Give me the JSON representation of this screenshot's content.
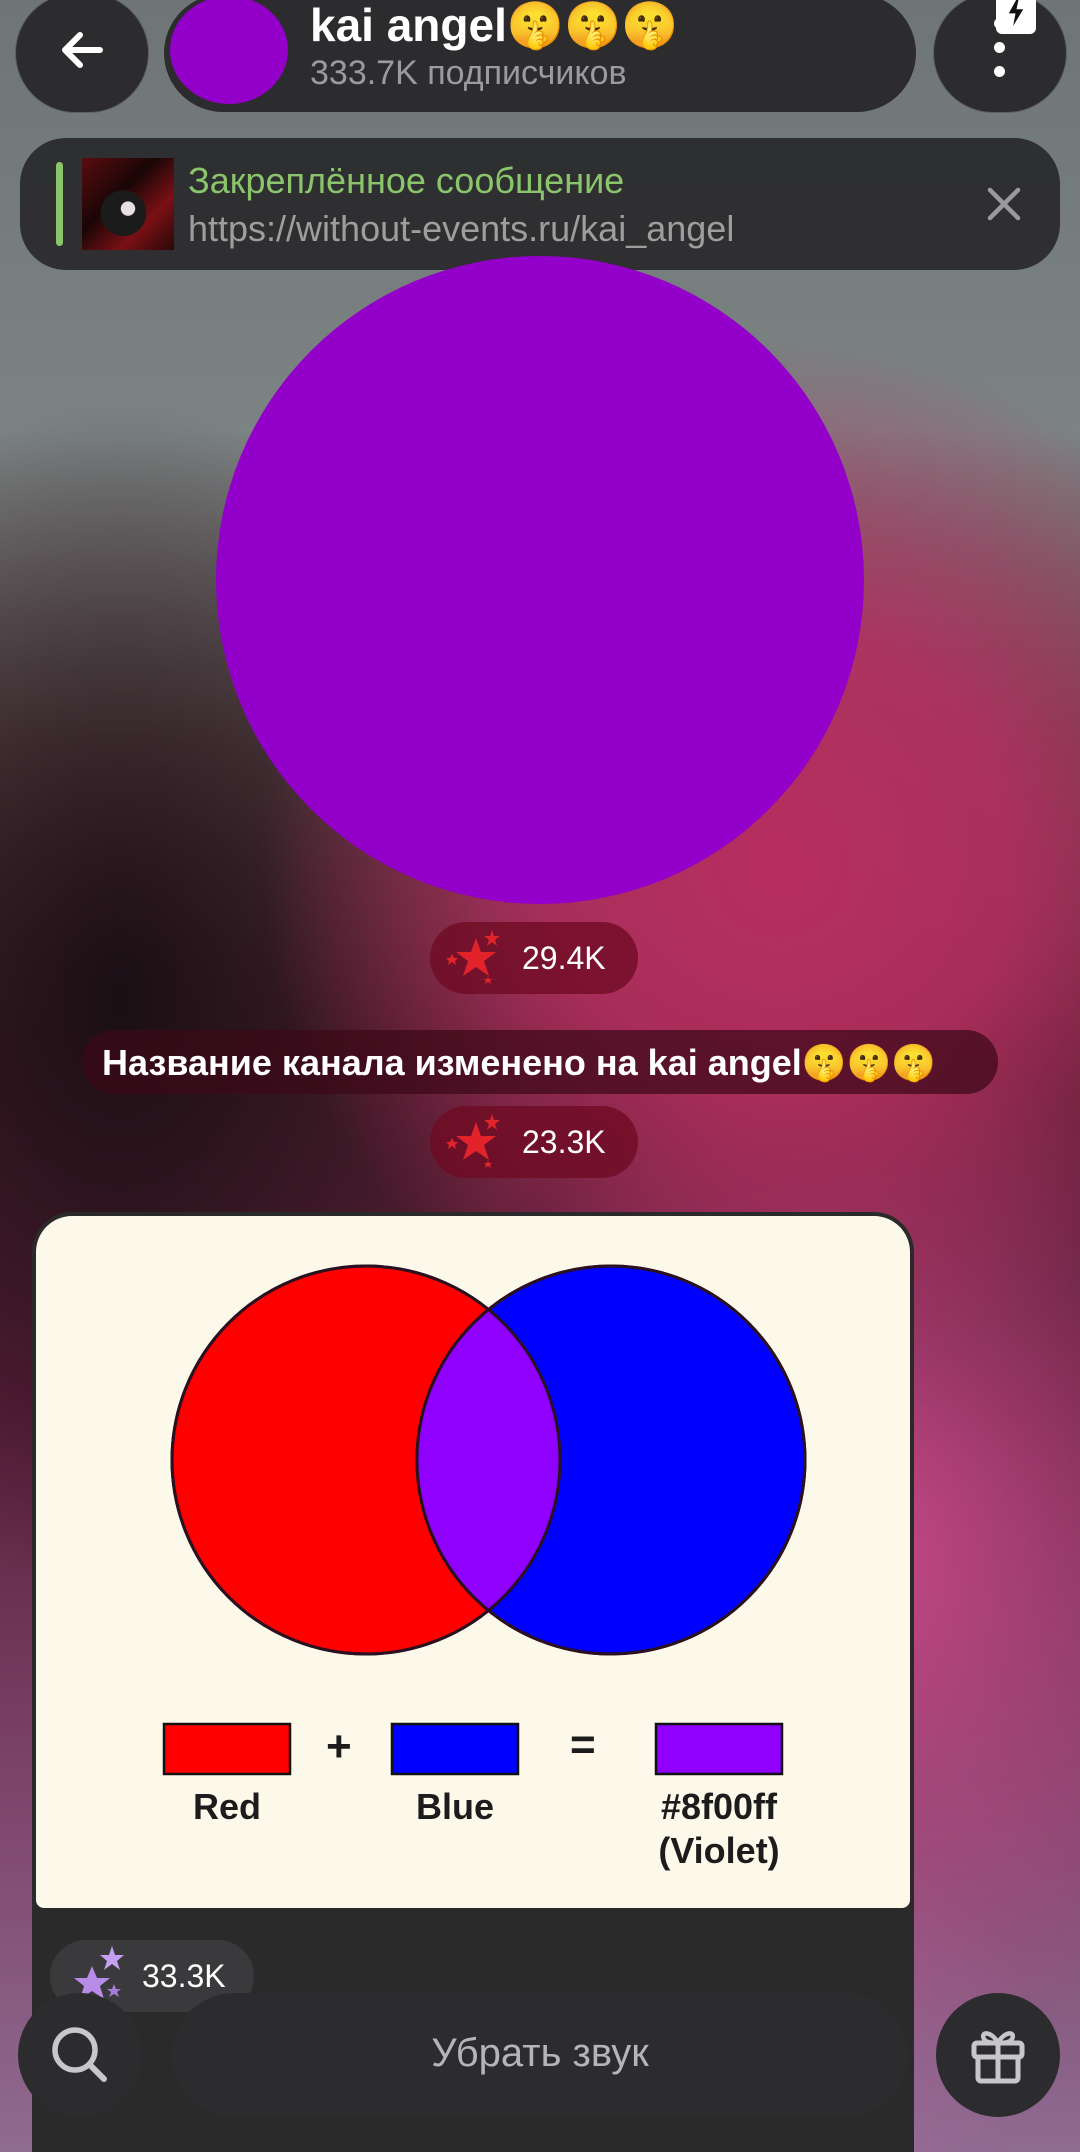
{
  "header": {
    "channel_name": "kai angel🤫🤫🤫",
    "subscribers": "333.7K подписчиков",
    "avatar_color": "#9300c9",
    "back_icon": "arrow-left-icon",
    "menu_icon": "more-vertical-icon"
  },
  "pinned": {
    "title": "Закреплённое сообщение",
    "text": "https://without-events.ru/kai_angel",
    "accent_color": "#8bc56b",
    "close_icon": "close-icon"
  },
  "messages": {
    "circle_color": "#9300c9",
    "reaction_1": "29.4K",
    "service_text": "Название канала изменено на kai angel🤫🤫🤫",
    "reaction_2": "23.3K",
    "card": {
      "label_red": "Red",
      "label_blue": "Blue",
      "label_violet_1": "#8f00ff",
      "label_violet_2": "(Violet)",
      "plus": "+",
      "equals": "=",
      "red": "#ff0000",
      "blue": "#0000ff",
      "violet": "#8f00ff"
    },
    "reaction_3": "33.3K"
  },
  "bottom": {
    "mute_label": "Убрать звук",
    "search_icon": "search-icon",
    "gift_icon": "gift-icon"
  }
}
